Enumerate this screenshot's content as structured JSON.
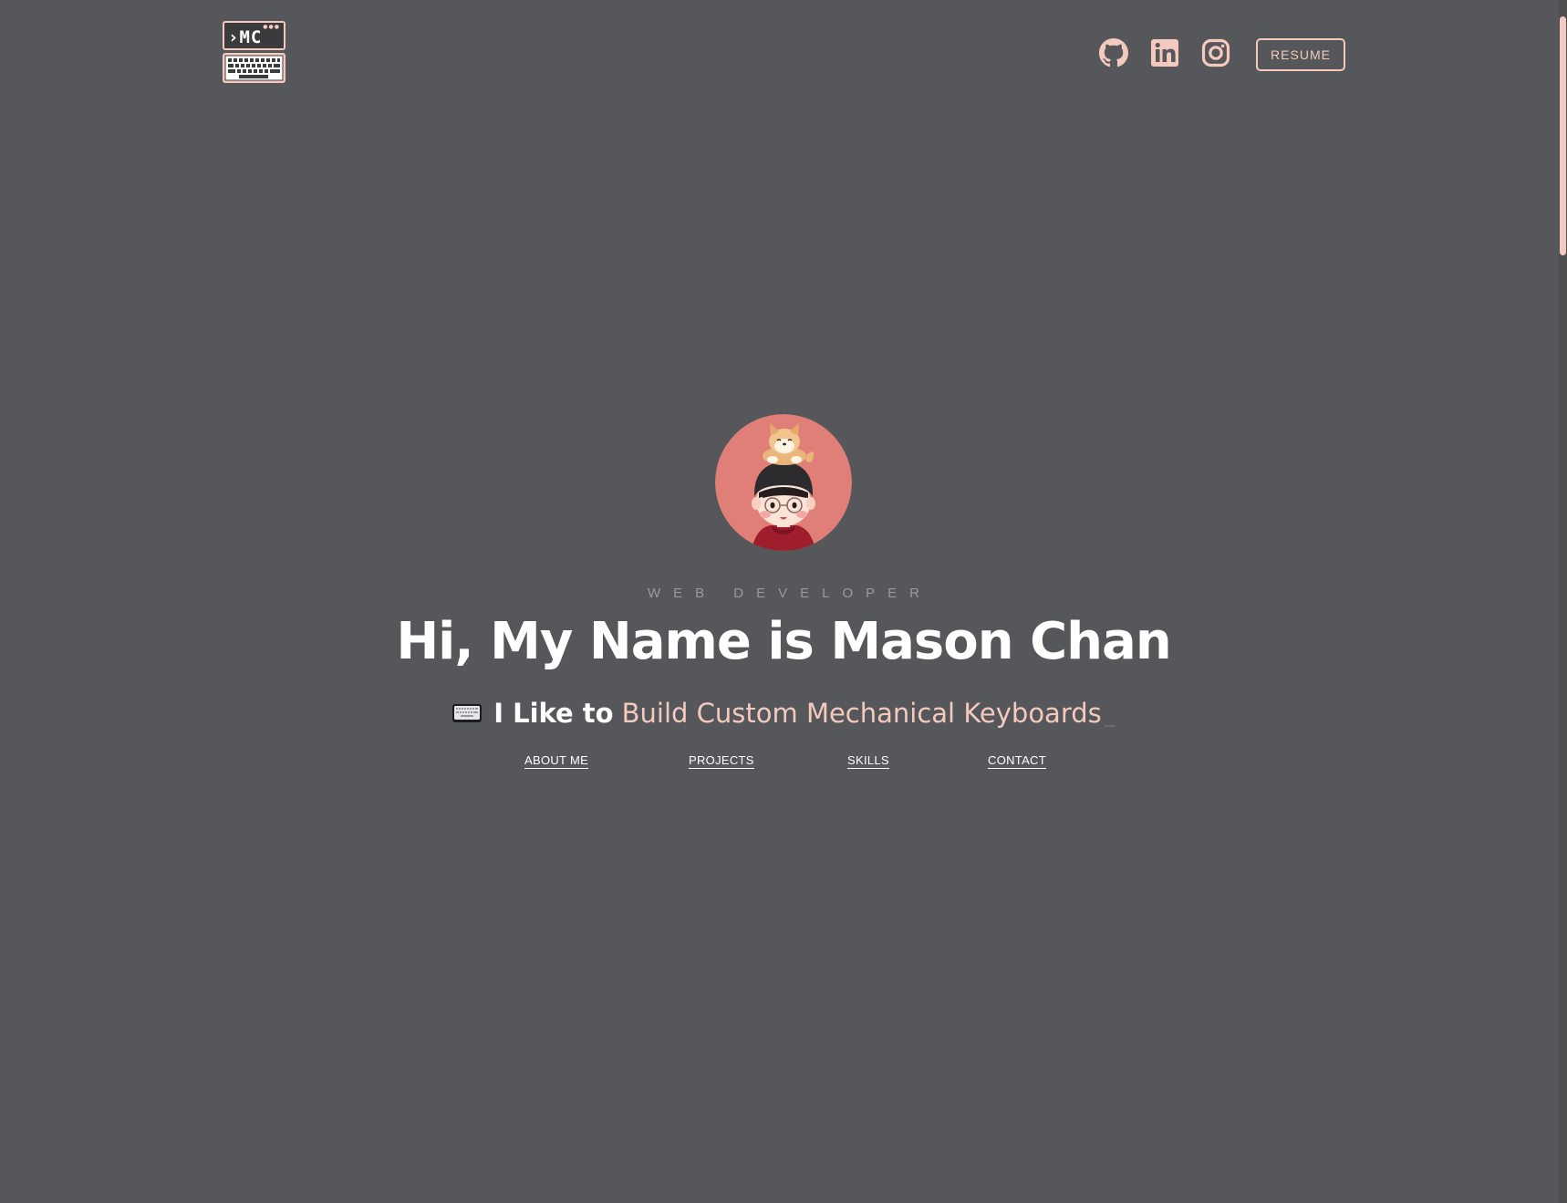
{
  "header": {
    "logo_text": "›MC",
    "social_links": [
      {
        "name": "github",
        "icon": "github-icon"
      },
      {
        "name": "linkedin",
        "icon": "linkedin-icon"
      },
      {
        "name": "instagram",
        "icon": "instagram-icon"
      }
    ],
    "resume_label": "RESUME"
  },
  "hero": {
    "role": "WEB DEVELOPER",
    "headline": "Hi, My Name is Mason Chan",
    "tagline_prefix": "I Like to",
    "tagline_highlight": "Build Custom Mechanical Keyboards",
    "tagline_icon": "keyboard-icon"
  },
  "section_nav": [
    {
      "label": "ABOUT ME"
    },
    {
      "label": "PROJECTS"
    },
    {
      "label": "SKILLS"
    },
    {
      "label": "CONTACT"
    }
  ],
  "colors": {
    "background": "#56575a",
    "accent": "#f4c9be",
    "text": "#ffffff",
    "muted": "#9a9a9c",
    "avatar_bg": "#e07f78"
  }
}
